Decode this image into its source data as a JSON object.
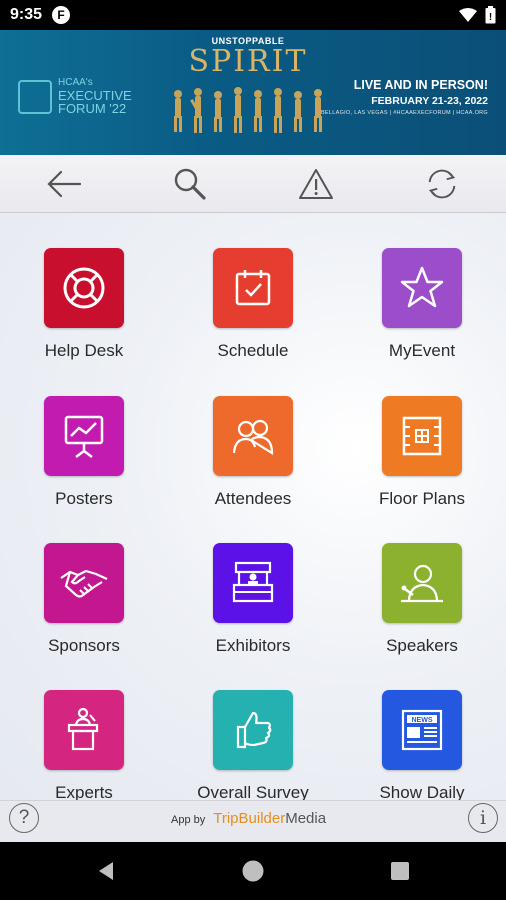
{
  "status_bar": {
    "time": "9:35",
    "app_badge": "F",
    "icons": [
      "wifi-icon",
      "battery-icon"
    ]
  },
  "banner": {
    "logo_text": "HCAA's",
    "forum_line1": "EXECUTIVE",
    "forum_line2": "FORUM '22",
    "tagline": "UNSTOPPABLE",
    "headline": "SPIRIT",
    "live": "LIVE AND IN PERSON!",
    "date": "FEBRUARY 21-23, 2022",
    "venue": "BELLAGIO, LAS VEGAS  |  #HCAAEXECFORUM  |  HCAA.ORG"
  },
  "toolbar": {
    "buttons": [
      "back-arrow-icon",
      "search-icon",
      "alert-icon",
      "refresh-icon"
    ]
  },
  "tiles": [
    {
      "label": "Help Desk",
      "icon": "lifebuoy-icon",
      "color": "#c8102e"
    },
    {
      "label": "Schedule",
      "icon": "calendar-check-icon",
      "color": "#e53d2f"
    },
    {
      "label": "MyEvent",
      "icon": "star-icon",
      "color": "#9b4dca"
    },
    {
      "label": "Posters",
      "icon": "easel-chart-icon",
      "color": "#c11bb0"
    },
    {
      "label": "Attendees",
      "icon": "people-icon",
      "color": "#ee6a2c"
    },
    {
      "label": "Floor Plans",
      "icon": "floorplan-icon",
      "color": "#ee7a24"
    },
    {
      "label": "Sponsors",
      "icon": "handshake-icon",
      "color": "#c2178f"
    },
    {
      "label": "Exhibitors",
      "icon": "booth-icon",
      "color": "#5c12e6"
    },
    {
      "label": "Speakers",
      "icon": "speaker-icon",
      "color": "#8bb12f"
    },
    {
      "label": "Experts",
      "icon": "podium-icon",
      "color": "#d42681"
    },
    {
      "label": "Overall Survey",
      "icon": "thumbs-up-icon",
      "color": "#25b1b0"
    },
    {
      "label": "Show Daily",
      "icon": "newspaper-icon",
      "color": "#2458e0"
    }
  ],
  "footer": {
    "app_by": "App by",
    "brand_trip": "TripBuilder",
    "brand_media": "Media",
    "help": "?",
    "info": "i"
  },
  "nav": [
    "back-icon",
    "home-icon",
    "recents-icon"
  ]
}
